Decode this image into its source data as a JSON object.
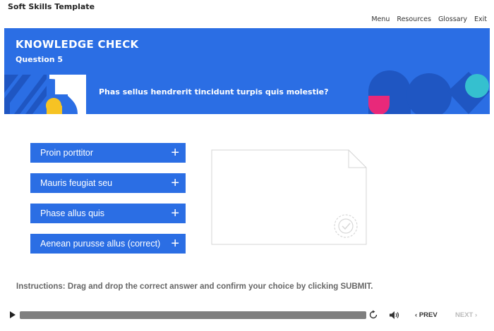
{
  "app": {
    "title": "Soft Skills Template"
  },
  "nav": {
    "menu": "Menu",
    "resources": "Resources",
    "glossary": "Glossary",
    "exit": "Exit"
  },
  "banner": {
    "heading": "KNOWLEDGE CHECK",
    "question_number": "Question 5",
    "question": "Phas sellus hendrerit tincidunt turpis quis molestie?"
  },
  "options": [
    {
      "label": "Proin porttitor"
    },
    {
      "label": "Mauris feugiat seu"
    },
    {
      "label": "Phase allus quis"
    },
    {
      "label": "Aenean purusse allus (correct)"
    }
  ],
  "instructions": "Instructions: Drag and drop the correct answer and confirm your choice by clicking SUBMIT.",
  "player": {
    "prev_label": "PREV",
    "next_label": "NEXT",
    "prev_icon": "chevron-left-icon",
    "next_icon": "chevron-right-icon"
  },
  "colors": {
    "accent": "#2b6ee4",
    "pink": "#e8297a",
    "yellow": "#f6c323",
    "teal": "#35c0cf",
    "dark_blue": "#1f56c2"
  }
}
